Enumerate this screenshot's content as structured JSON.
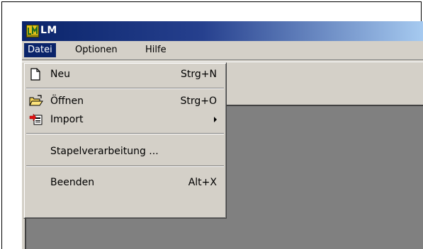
{
  "window": {
    "title": "LM"
  },
  "menubar": {
    "items": [
      "Datei",
      "Optionen",
      "Hilfe"
    ]
  },
  "file_menu": {
    "new": {
      "label": "Neu",
      "shortcut": "Strg+N",
      "icon": "new-document-icon"
    },
    "open": {
      "label": "Öffnen",
      "shortcut": "Strg+O",
      "icon": "open-folder-icon"
    },
    "import": {
      "label": "Import",
      "icon": "import-icon",
      "submenu": true
    },
    "batch": {
      "label": "Stapelverarbeitung ..."
    },
    "exit": {
      "label": "Beenden",
      "shortcut": "Alt+X"
    }
  },
  "colors": {
    "titlebar": "#0a246a",
    "face": "#d4d0c8",
    "highlight": "#0a246a"
  }
}
